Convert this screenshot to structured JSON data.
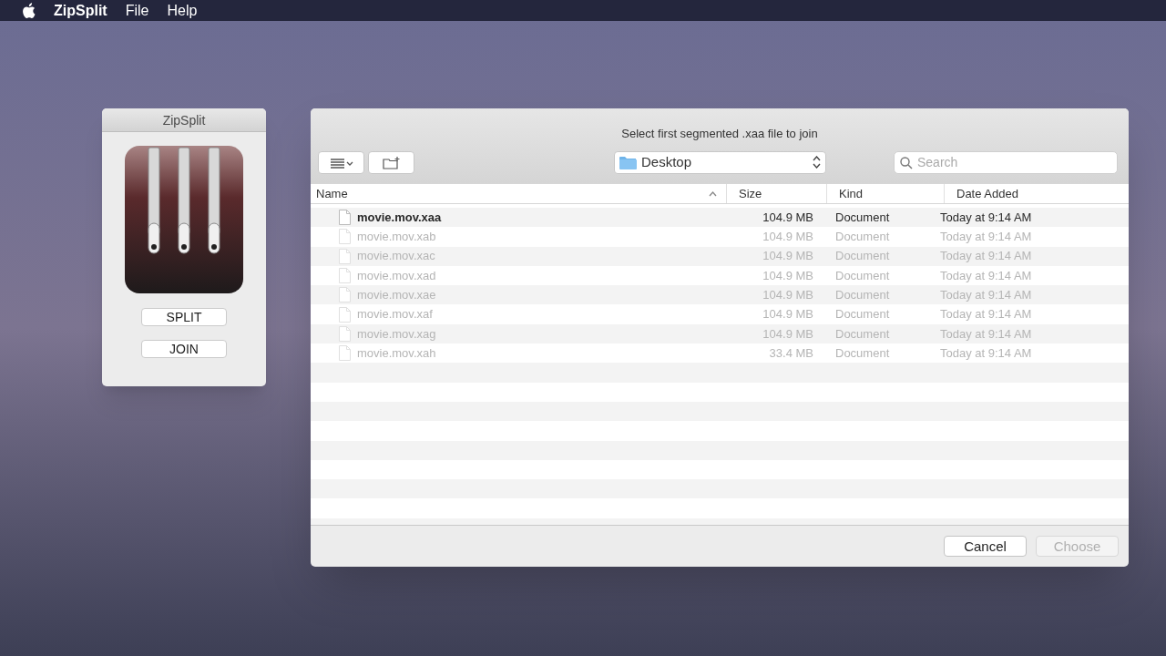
{
  "menu_bar": {
    "app_name": "ZipSplit",
    "items": [
      "File",
      "Help"
    ]
  },
  "app_window": {
    "title": "ZipSplit",
    "buttons": [
      "SPLIT",
      "JOIN"
    ]
  },
  "dialog": {
    "title": "Select first segmented .xaa file to join",
    "location": "Desktop",
    "search": {
      "placeholder": "Search"
    },
    "columns": [
      {
        "label": "Name",
        "sorted": true
      },
      {
        "label": "Size",
        "sorted": false
      },
      {
        "label": "Kind",
        "sorted": false
      },
      {
        "label": "Date Added",
        "sorted": false
      }
    ],
    "rows": [
      {
        "name": "movie.mov.xaa",
        "size": "104.9 MB",
        "kind": "Document",
        "date_added": "Today at 9:14 AM",
        "disabled": false
      },
      {
        "name": "movie.mov.xab",
        "size": "104.9 MB",
        "kind": "Document",
        "date_added": "Today at 9:14 AM",
        "disabled": true
      },
      {
        "name": "movie.mov.xac",
        "size": "104.9 MB",
        "kind": "Document",
        "date_added": "Today at 9:14 AM",
        "disabled": true
      },
      {
        "name": "movie.mov.xad",
        "size": "104.9 MB",
        "kind": "Document",
        "date_added": "Today at 9:14 AM",
        "disabled": true
      },
      {
        "name": "movie.mov.xae",
        "size": "104.9 MB",
        "kind": "Document",
        "date_added": "Today at 9:14 AM",
        "disabled": true
      },
      {
        "name": "movie.mov.xaf",
        "size": "104.9 MB",
        "kind": "Document",
        "date_added": "Today at 9:14 AM",
        "disabled": true
      },
      {
        "name": "movie.mov.xag",
        "size": "104.9 MB",
        "kind": "Document",
        "date_added": "Today at 9:14 AM",
        "disabled": true
      },
      {
        "name": "movie.mov.xah",
        "size": "33.4 MB",
        "kind": "Document",
        "date_added": "Today at 9:14 AM",
        "disabled": true
      }
    ],
    "buttons": [
      {
        "label": "Cancel",
        "disabled": false
      },
      {
        "label": "Choose",
        "disabled": true
      }
    ]
  }
}
